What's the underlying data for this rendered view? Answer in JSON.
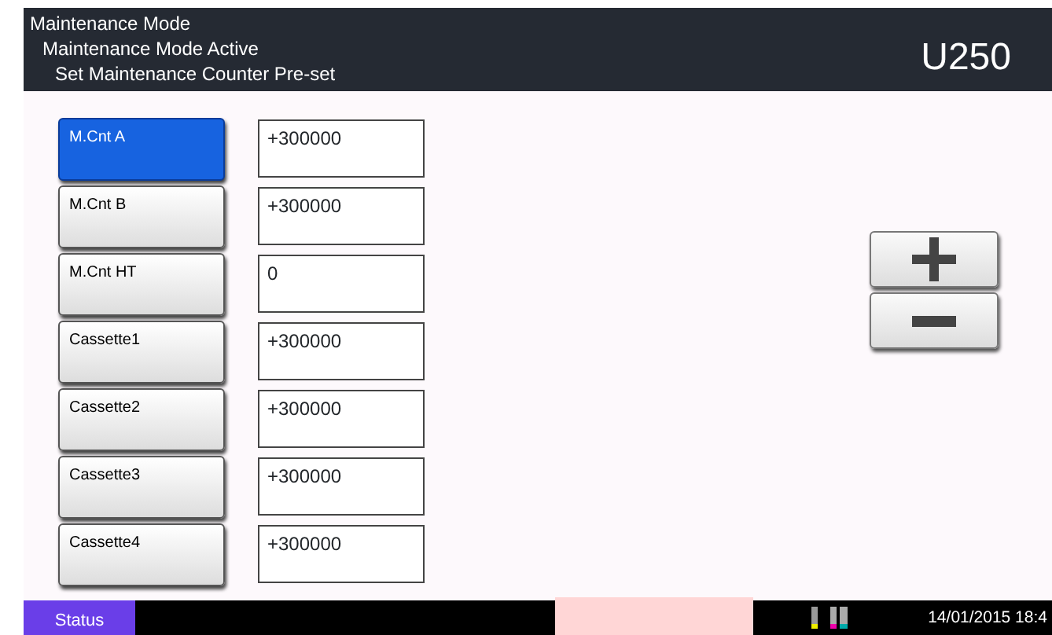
{
  "header": {
    "lines": [
      "Maintenance Mode",
      "Maintenance Mode Active",
      "Set Maintenance Counter Pre-set"
    ],
    "code": "U250"
  },
  "counters": [
    {
      "label": "M.Cnt A",
      "value": "+300000",
      "selected": true
    },
    {
      "label": "M.Cnt B",
      "value": "+300000",
      "selected": false
    },
    {
      "label": "M.Cnt HT",
      "value": "0",
      "selected": false
    },
    {
      "label": "Cassette1",
      "value": "+300000",
      "selected": false
    },
    {
      "label": "Cassette2",
      "value": "+300000",
      "selected": false
    },
    {
      "label": "Cassette3",
      "value": "+300000",
      "selected": false
    },
    {
      "label": "Cassette4",
      "value": "+300000",
      "selected": false
    }
  ],
  "status_bar": {
    "status_button": "Status",
    "datetime": "14/01/2015 18:4"
  }
}
